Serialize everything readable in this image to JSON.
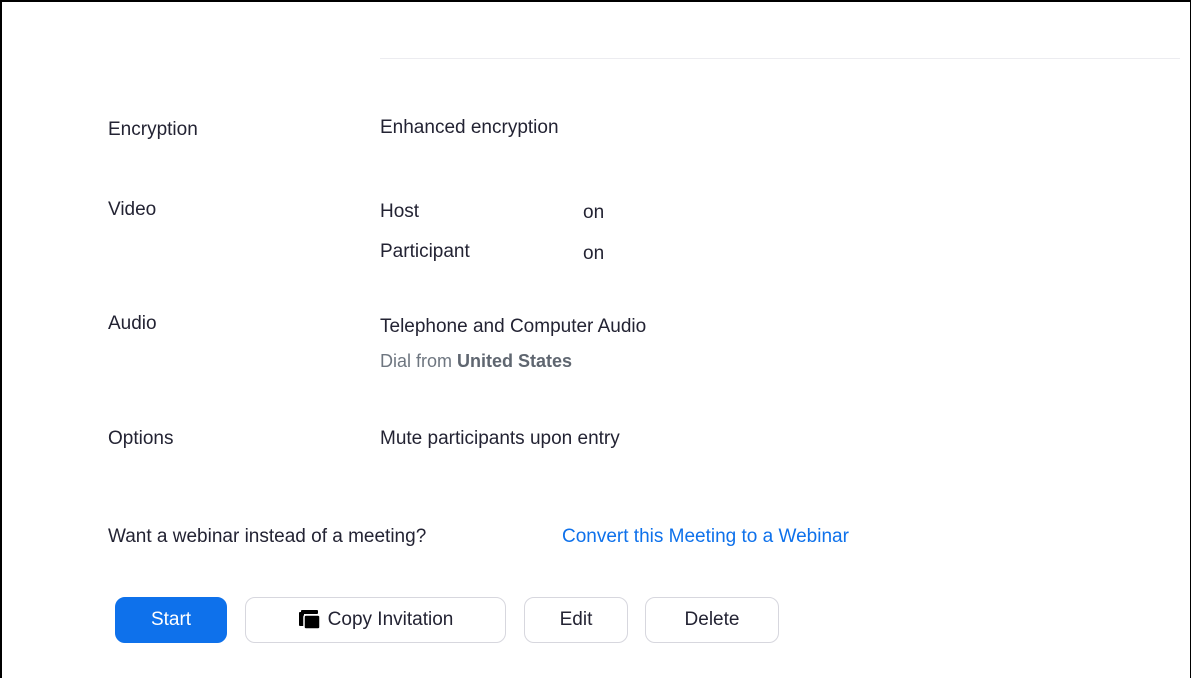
{
  "rows": {
    "encryption": {
      "label": "Encryption",
      "value": "Enhanced encryption"
    },
    "video": {
      "label": "Video",
      "host_label": "Host",
      "host_value": "on",
      "participant_label": "Participant",
      "participant_value": "on"
    },
    "audio": {
      "label": "Audio",
      "value": "Telephone and Computer Audio",
      "dial_prefix": "Dial from",
      "dial_country": "United States"
    },
    "options": {
      "label": "Options",
      "value": "Mute participants upon entry"
    }
  },
  "webinar": {
    "question": "Want a webinar instead of a meeting?",
    "link": "Convert this Meeting to a Webinar"
  },
  "actions": {
    "start": "Start",
    "copy_invitation": "Copy Invitation",
    "edit": "Edit",
    "delete": "Delete"
  },
  "colors": {
    "accent": "#0e71eb",
    "text": "#232333",
    "muted": "#6e7680"
  },
  "icons": {
    "copy": "copy-icon"
  }
}
